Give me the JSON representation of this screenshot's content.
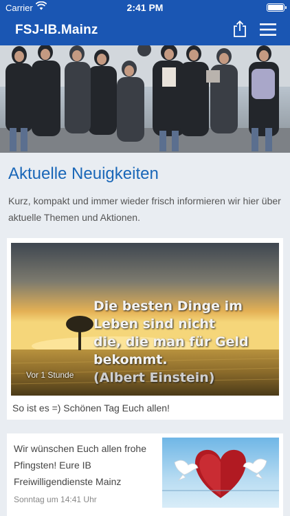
{
  "status_bar": {
    "carrier": "Carrier",
    "time": "2:41 PM",
    "wifi_icon": "wifi-icon",
    "battery_icon": "battery-icon"
  },
  "nav": {
    "title": "FSJ-IB.Mainz",
    "share_icon": "share-icon",
    "menu_icon": "hamburger-menu-icon"
  },
  "colors": {
    "brand": "#1a56b3",
    "heading": "#1a67b8",
    "background": "#e9edf2"
  },
  "section": {
    "title": "Aktuelle Neuigkeiten",
    "intro": "Kurz, kompakt und immer wieder frisch informieren wir hier über aktuelle Themen und Aktionen."
  },
  "posts": [
    {
      "image_quote_lines": [
        "Die besten Dinge im",
        "Leben sind nicht",
        "die, die man für Geld",
        "bekommt."
      ],
      "image_quote_author": "(Albert Einstein)",
      "time": "Vor 1 Stunde",
      "caption": "So ist es =) Schönen Tag Euch allen!"
    },
    {
      "text": "Wir wünschen Euch allen frohe Pfingsten! Eure IB Freiwilligendienste Mainz",
      "time": "Sonntag um 14:41 Uhr",
      "thumbnail": "heart-with-doves"
    }
  ]
}
